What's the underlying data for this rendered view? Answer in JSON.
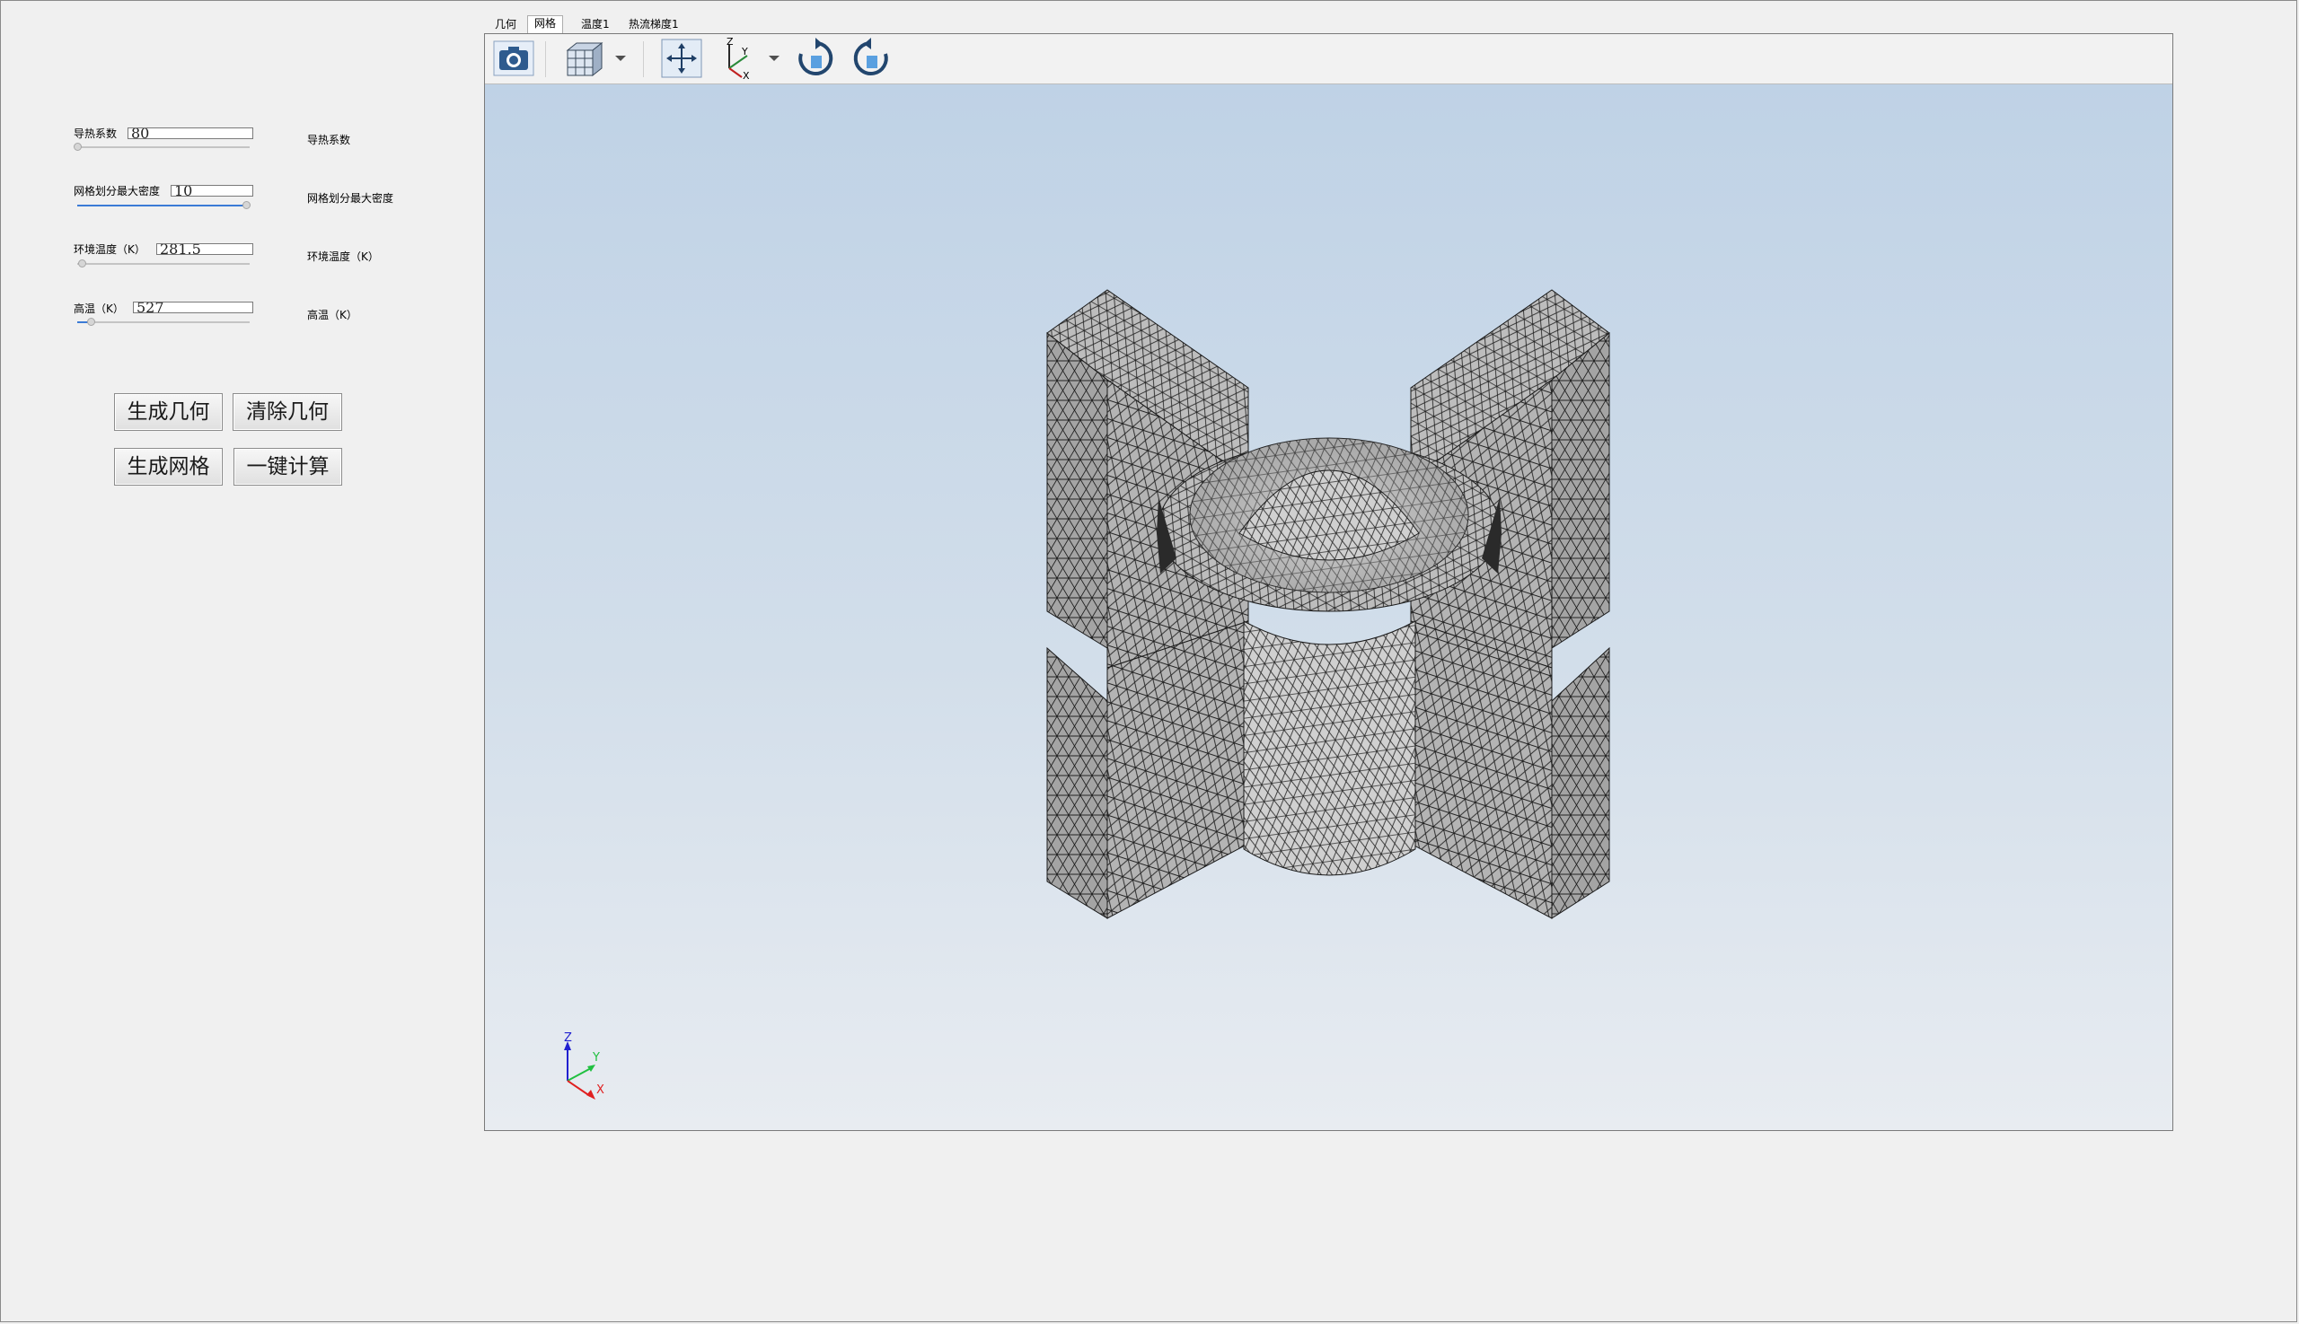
{
  "params": [
    {
      "label": "导热系数",
      "value": "80",
      "side_label": "导热系数",
      "slider_fraction": 0.0
    },
    {
      "label": "网格划分最大密度",
      "value": "10",
      "side_label": "网格划分最大密度",
      "slider_fraction": 1.0
    },
    {
      "label": "环境温度（K）",
      "value": "281.5",
      "side_label": "环境温度（K）",
      "slider_fraction": 0.03
    },
    {
      "label": "高温（K）",
      "value": "527",
      "side_label": "高温（K）",
      "slider_fraction": 0.08
    }
  ],
  "buttons": {
    "generate_geometry": "生成几何",
    "clear_geometry": "清除几何",
    "generate_mesh": "生成网格",
    "compute": "一键计算"
  },
  "tabs": [
    "几何",
    "网格",
    "温度1",
    "热流梯度1"
  ],
  "active_tab": "网格",
  "toolbar": {
    "icons": [
      "camera-icon",
      "view-cube-icon",
      "fit-view-icon",
      "axes-orientation-icon",
      "rotate-clockwise-icon",
      "rotate-counterclockwise-icon"
    ]
  },
  "axes": {
    "x": "X",
    "y": "Y",
    "z": "Z"
  },
  "colors": {
    "mesh_face": "#a8a8a8",
    "mesh_face_light": "#d0d0d0",
    "mesh_edge": "#1e1e1e",
    "axis_x": "#e02020",
    "axis_y": "#20c040",
    "axis_z": "#2020d0",
    "slider_fill": "#3b7bd6"
  }
}
